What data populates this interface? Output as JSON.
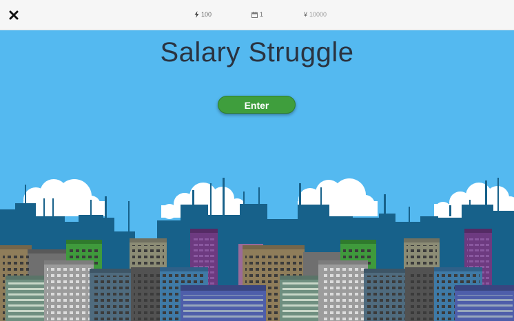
{
  "topbar": {
    "close_icon": "close-icon",
    "energy": {
      "icon": "lightning-icon",
      "value": "100"
    },
    "day": {
      "icon": "calendar-icon",
      "value": "1"
    },
    "money": {
      "icon": "yen-icon",
      "symbol": "¥",
      "value": "10000"
    }
  },
  "game": {
    "title": "Salary Struggle",
    "enter_label": "Enter"
  },
  "colors": {
    "sky": "#54b9f0",
    "button": "#3f9e3d",
    "back_buildings": "#17618a",
    "title_text": "#2a3340"
  }
}
